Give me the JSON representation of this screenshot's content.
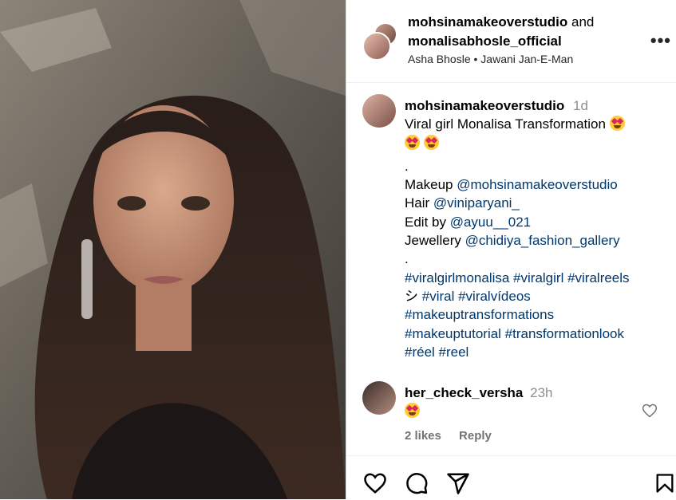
{
  "header": {
    "author1": "mohsinamakeoverstudio",
    "and_text": "and",
    "author2": "monalisabhosle_official",
    "audio_artist": "Asha Bhosle",
    "audio_separator": "•",
    "audio_title": "Jawani Jan-E-Man",
    "more_label": "•••"
  },
  "caption": {
    "username": "mohsinamakeoverstudio",
    "time": "1d",
    "text": "Viral girl Monalisa Transformation",
    "dot1": ".",
    "makeup_label": "Makeup",
    "makeup_handle": "@mohsinamakeoverstudio",
    "hair_label": "Hair",
    "hair_handle": "@viniparyani_",
    "edit_label": "Edit by",
    "edit_handle": "@ayuu__021",
    "jewellery_label": "Jewellery",
    "jewellery_handle": "@chidiya_fashion_gallery",
    "dot2": ".",
    "hashtags_line1": "#viralgirlmonalisa #viralgirl #viralreels",
    "hashtags_line2_prefix": "シ",
    "hashtags_line2": "#viral #viralvídeos",
    "hashtags_line3": "#makeuptransformations",
    "hashtags_line4": "#makeuptutorial #transformationlook",
    "hashtags_line5": "#réel #reel"
  },
  "comment": {
    "username": "her_check_versha",
    "time": "23h",
    "likes": "2 likes",
    "reply": "Reply"
  },
  "icons": {
    "like": "heart-icon",
    "comment": "comment-icon",
    "share": "share-icon",
    "save": "bookmark-icon",
    "emoji": "heart-eyes-emoji"
  },
  "colors": {
    "link": "#00376b",
    "muted": "#8e8e8e",
    "divider": "#dbdbdb"
  }
}
